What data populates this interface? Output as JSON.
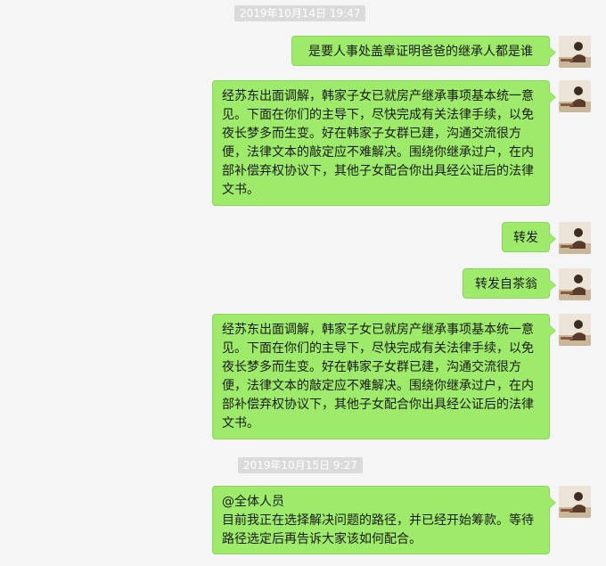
{
  "chat": {
    "timestamps": [
      "2019年10月14日 19:47",
      "2019年10月15日 9:27"
    ],
    "messages": [
      {
        "sender": "self",
        "text": "是要人事处盖章证明爸爸的继承人都是谁"
      },
      {
        "sender": "self",
        "text": "经苏东出面调解，韩家子女已就房产继承事项基本统一意见。下面在你们的主导下，尽快完成有关法律手续，以免夜长梦多而生变。好在韩家子女群已建，沟通交流很方便，法律文本的敲定应不难解决。围绕你继承过户，在内部补偿弃权协议下，其他子女配合你出具经公证后的法律文书。"
      },
      {
        "sender": "self",
        "text": "转发"
      },
      {
        "sender": "self",
        "text": "转发自茶翁"
      },
      {
        "sender": "self",
        "text": "经苏东出面调解，韩家子女已就房产继承事项基本统一意见。下面在你们的主导下，尽快完成有关法律手续，以免夜长梦多而生变。好在韩家子女群已建，沟通交流很方便，法律文本的敲定应不难解决。围绕你继承过户，在内部补偿弃权协议下，其他子女配合你出具经公证后的法律文书。"
      },
      {
        "sender": "self",
        "text": "@全体人员\n目前我正在选择解决问题的路径，并已经开始筹款。等待路径选定后再告诉大家该如何配合。"
      }
    ],
    "colors": {
      "background": "#f5f5f5",
      "bubble_self": "#9eea6a",
      "timestamp_bg": "#dadada"
    }
  }
}
